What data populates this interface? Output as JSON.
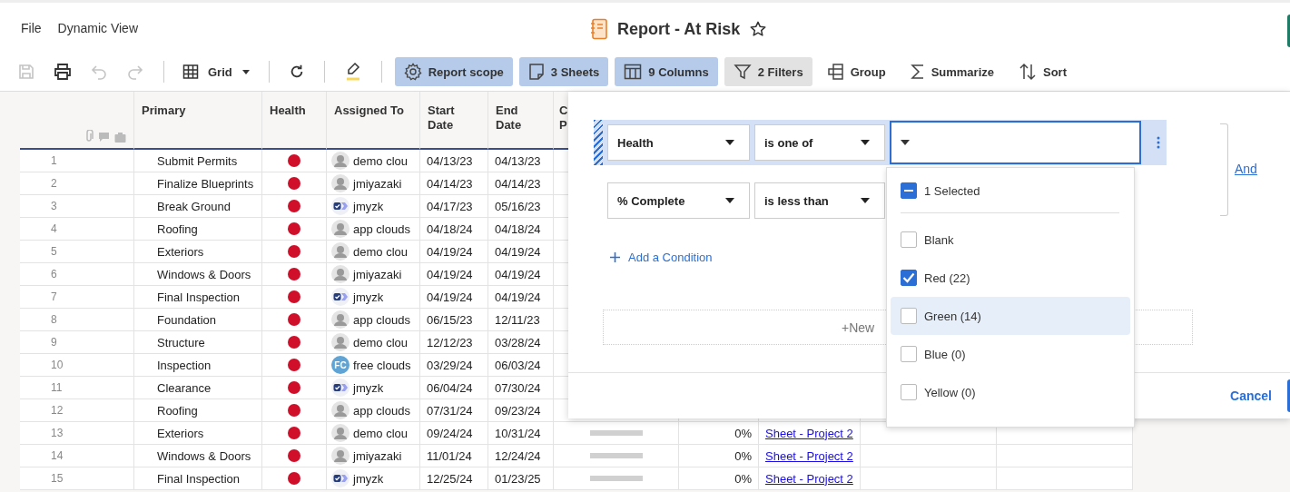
{
  "menu": [
    "File",
    "Dynamic View"
  ],
  "title": "Report - At Risk",
  "favorite": false,
  "toolbar": {
    "actions": [
      {
        "disabled": true
      },
      {
        "disabled": false
      },
      {
        "disabled": true
      },
      {
        "disabled": true
      }
    ],
    "view": "Grid",
    "tools": [
      {
        "label": "Report scope",
        "applied": true,
        "open": false
      },
      {
        "label": "3 Sheets",
        "applied": true,
        "open": false
      },
      {
        "label": "9 Columns",
        "applied": true,
        "open": false
      },
      {
        "label": "2 Filters",
        "applied": false,
        "open": true
      },
      {
        "label": "Group",
        "applied": false,
        "open": false
      },
      {
        "label": "Summarize",
        "applied": false,
        "open": false
      },
      {
        "label": "Sort",
        "applied": false,
        "open": false
      }
    ]
  },
  "table": {
    "columns": [
      "Primary",
      "Health",
      "Assigned To",
      "Start Date",
      "End Date",
      "C P"
    ],
    "rows": [
      {
        "num": "1",
        "primary": "Submit Permits",
        "color": "#d0102a",
        "assigned": {
          "name": "demo clou",
          "kind": "photo"
        },
        "start": "04/13/23",
        "end": "04/13/23"
      },
      {
        "num": "2",
        "primary": "Finalize Blueprints",
        "color": "#d0102a",
        "assigned": {
          "name": "jmiyazaki",
          "kind": "photo"
        },
        "start": "04/14/23",
        "end": "04/14/23"
      },
      {
        "num": "3",
        "primary": "Break Ground",
        "color": "#d0102a",
        "assigned": {
          "name": "jmyzk",
          "kind": "app"
        },
        "start": "04/17/23",
        "end": "05/16/23"
      },
      {
        "num": "4",
        "primary": "Roofing",
        "color": "#d0102a",
        "assigned": {
          "name": "app clouds",
          "kind": "photo"
        },
        "start": "04/18/24",
        "end": "04/18/24"
      },
      {
        "num": "5",
        "primary": "Exteriors",
        "color": "#d0102a",
        "assigned": {
          "name": "demo clou",
          "kind": "photo"
        },
        "start": "04/19/24",
        "end": "04/19/24"
      },
      {
        "num": "6",
        "primary": "Windows & Doors",
        "color": "#d0102a",
        "assigned": {
          "name": "jmiyazaki",
          "kind": "photo"
        },
        "start": "04/19/24",
        "end": "04/19/24"
      },
      {
        "num": "7",
        "primary": "Final Inspection",
        "color": "#d0102a",
        "assigned": {
          "name": "jmyzk",
          "kind": "app"
        },
        "start": "04/19/24",
        "end": "04/19/24"
      },
      {
        "num": "8",
        "primary": "Foundation",
        "color": "#d0102a",
        "assigned": {
          "name": "app clouds",
          "kind": "photo"
        },
        "start": "06/15/23",
        "end": "12/11/23"
      },
      {
        "num": "9",
        "primary": "Structure",
        "color": "#d0102a",
        "assigned": {
          "name": "demo clou",
          "kind": "photo"
        },
        "start": "12/12/23",
        "end": "03/28/24"
      },
      {
        "num": "10",
        "primary": "Inspection",
        "color": "#d0102a",
        "assigned": {
          "name": "free clouds",
          "kind": "initials",
          "initials": "FC"
        },
        "start": "03/29/24",
        "end": "06/03/24"
      },
      {
        "num": "11",
        "primary": "Clearance",
        "color": "#d0102a",
        "assigned": {
          "name": "jmyzk",
          "kind": "app"
        },
        "start": "06/04/24",
        "end": "07/30/24"
      },
      {
        "num": "12",
        "primary": "Roofing",
        "color": "#d0102a",
        "assigned": {
          "name": "app clouds",
          "kind": "photo"
        },
        "start": "07/31/24",
        "end": "09/23/24"
      },
      {
        "num": "13",
        "primary": "Exteriors",
        "color": "#d0102a",
        "assigned": {
          "name": "demo clou",
          "kind": "photo"
        },
        "start": "09/24/24",
        "end": "10/31/24",
        "progress": {
          "level": 0
        },
        "percent": "0%",
        "sheet": "Sheet - Project 2"
      },
      {
        "num": "14",
        "primary": "Windows & Doors",
        "color": "#d0102a",
        "assigned": {
          "name": "jmiyazaki",
          "kind": "photo"
        },
        "start": "11/01/24",
        "end": "12/24/24",
        "progress": {
          "level": 0
        },
        "percent": "0%",
        "sheet": "Sheet - Project 2"
      },
      {
        "num": "15",
        "primary": "Final Inspection",
        "color": "#d0102a",
        "assigned": {
          "name": "jmyzk",
          "kind": "app"
        },
        "start": "12/25/24",
        "end": "01/23/25",
        "progress": {
          "level": 0
        },
        "percent": "0%",
        "sheet": "Sheet - Project 2"
      }
    ]
  },
  "filter": {
    "conditions": [
      {
        "field": "Health",
        "operator": "is one of",
        "active": true
      },
      {
        "field": "% Complete",
        "operator": "is less than",
        "active": false
      }
    ],
    "conjunction": "And",
    "add_condition": "Add a Condition",
    "new_group": "+New",
    "cancel": "Cancel",
    "dropdown": {
      "summary": "1 Selected",
      "partial": true,
      "options": [
        {
          "label": "Blank",
          "checked": false,
          "highlighted": false
        },
        {
          "label": "Red (22)",
          "checked": true,
          "highlighted": false
        },
        {
          "label": "Green (14)",
          "checked": false,
          "highlighted": true
        },
        {
          "label": "Blue (0)",
          "checked": false,
          "highlighted": false
        },
        {
          "label": "Yellow (0)",
          "checked": false,
          "highlighted": false
        }
      ]
    }
  }
}
